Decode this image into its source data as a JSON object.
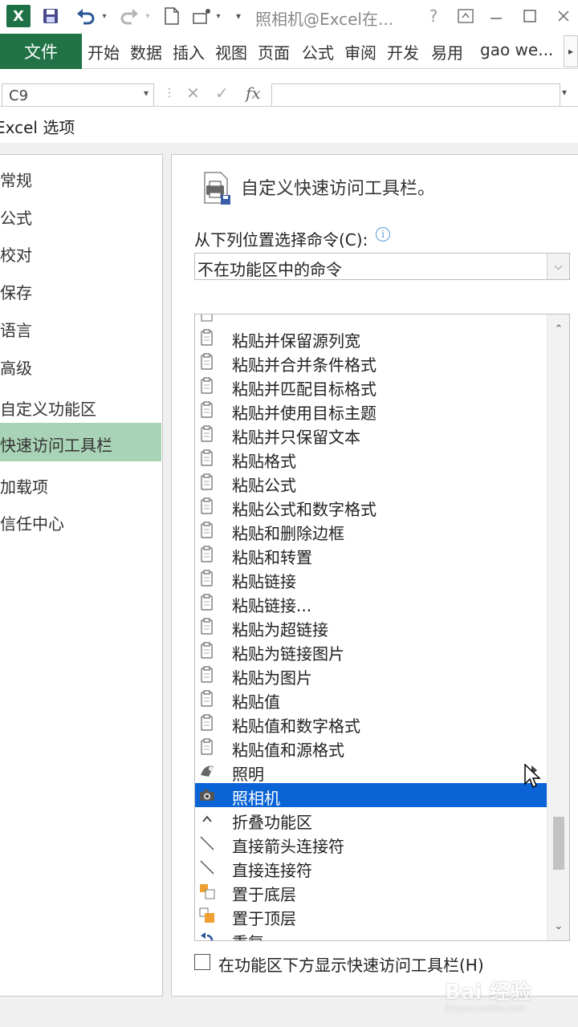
{
  "colors": {
    "excel_green": "#217346",
    "nav_selected": "#a9d3b6",
    "list_selected": "#0a64d6"
  },
  "titlebar": {
    "title": "照相机@Excel在...",
    "help": "?",
    "icons": [
      "excel-logo-icon",
      "save-icon",
      "undo-icon",
      "redo-icon",
      "new-file-icon",
      "touch-mode-icon",
      "customize-qat-icon",
      "ribbon-display-icon",
      "minimize-icon",
      "maximize-icon",
      "close-icon"
    ]
  },
  "ribbon": {
    "file": "文件",
    "tabs": [
      "开始",
      "数据",
      "插入",
      "视图",
      "页面",
      "公式",
      "审阅",
      "开发",
      "易用"
    ],
    "user": "gao we..."
  },
  "formula_bar": {
    "name_box": "C9",
    "fx": "fx"
  },
  "dialog": {
    "title": "Excel 选项"
  },
  "nav": {
    "items": [
      "常规",
      "公式",
      "校对",
      "保存",
      "语言",
      "高级",
      "自定义功能区",
      "快速访问工具栏",
      "加载项",
      "信任中心"
    ],
    "selected": "快速访问工具栏"
  },
  "content": {
    "section_title": "自定义快速访问工具栏。",
    "choose_label": "从下列位置选择命令(C):",
    "choose_value": "不在功能区中的命令",
    "commands": [
      "粘贴并保留源列宽",
      "粘贴并合并条件格式",
      "粘贴并匹配目标格式",
      "粘贴并使用目标主题",
      "粘贴并只保留文本",
      "粘贴格式",
      "粘贴公式",
      "粘贴公式和数字格式",
      "粘贴和删除边框",
      "粘贴和转置",
      "粘贴链接",
      "粘贴链接...",
      "粘贴为超链接",
      "粘贴为链接图片",
      "粘贴为图片",
      "粘贴值",
      "粘贴值和数字格式",
      "粘贴值和源格式",
      "照明",
      "照相机",
      "折叠功能区",
      "直接箭头连接符",
      "直接连接符",
      "置于底层",
      "置于顶层",
      "重复"
    ],
    "selected_command": "照相机",
    "checkbox_label": "在功能区下方显示快速访问工具栏(H)",
    "checkbox_checked": false
  },
  "watermark": {
    "text": "Bai 经验",
    "sub": "jingyan.baidu.com"
  }
}
